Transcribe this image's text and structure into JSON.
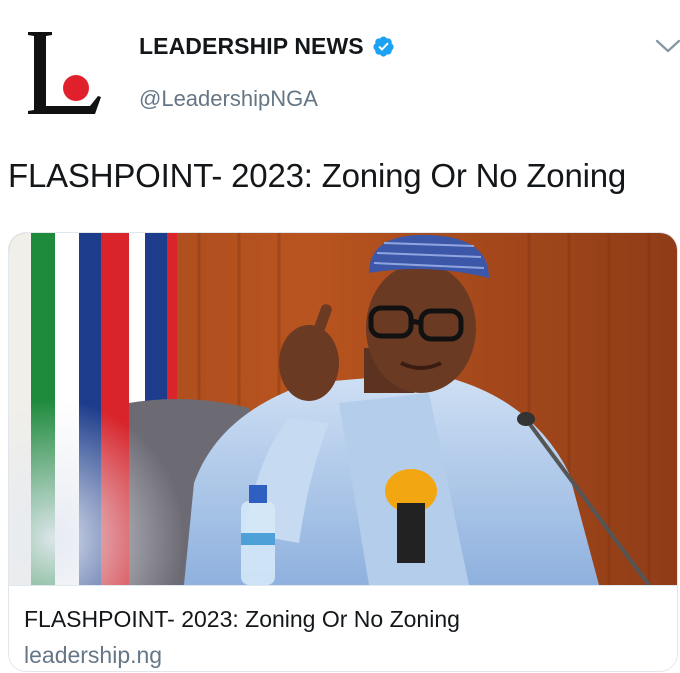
{
  "account": {
    "display_name": "LEADERSHIP NEWS",
    "handle": "@LeadershipNGA",
    "verified": true,
    "logo_icon": "leadership-logo-icon",
    "verified_icon": "verified-badge-icon"
  },
  "menu": {
    "icon": "chevron-down-icon"
  },
  "tweet": {
    "text": "FLASHPOINT- 2023: Zoning Or No Zoning"
  },
  "card": {
    "title": "FLASHPOINT- 2023: Zoning Or No Zoning",
    "domain": "leadership.ng",
    "image": "photo of a man in light blue attire and patterned cap gesturing at a microphone in front of flags and wooden panels"
  },
  "colors": {
    "text_primary": "#14171a",
    "text_secondary": "#657786",
    "verified_blue": "#1da1f2",
    "logo_red": "#e0202a",
    "border": "#e1e8ed"
  }
}
